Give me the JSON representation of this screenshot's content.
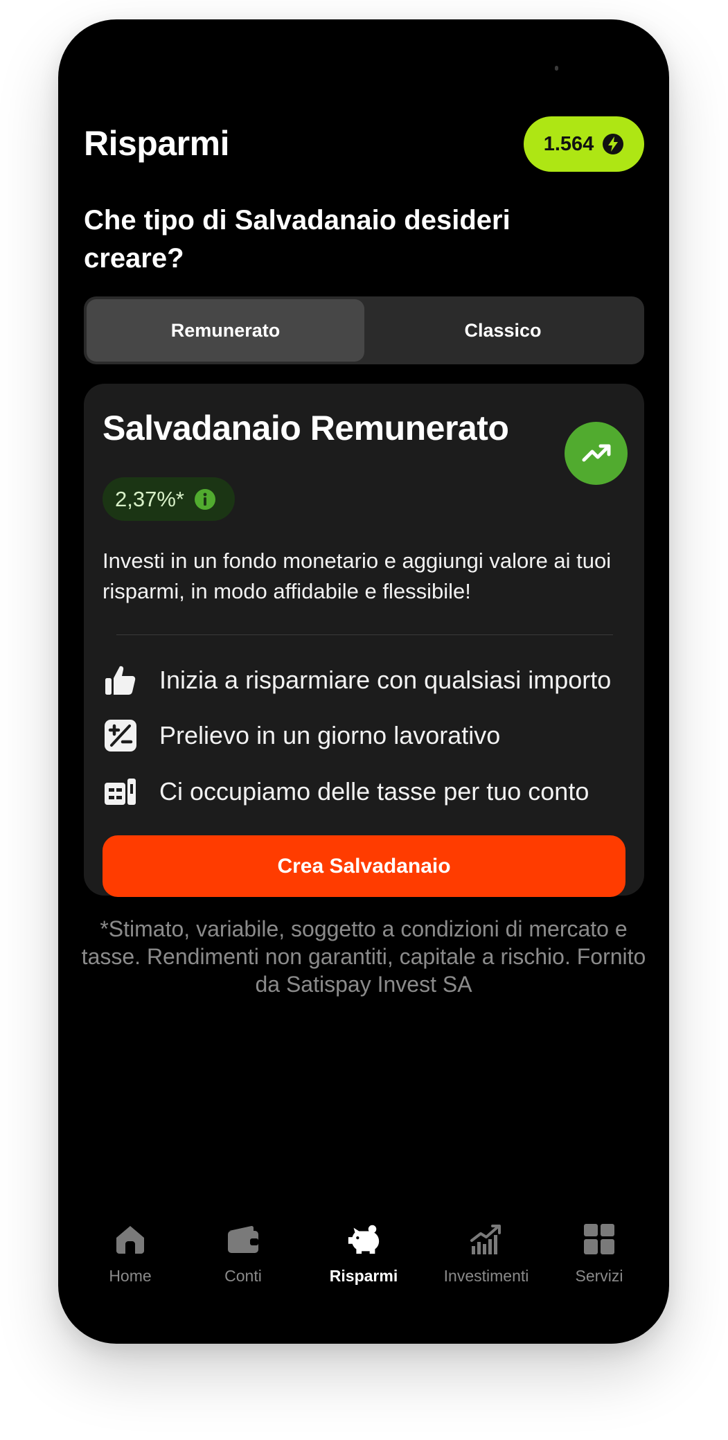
{
  "header": {
    "title": "Risparmi",
    "points": "1.564"
  },
  "question": "Che tipo di Salvadanaio desideri creare?",
  "segments": {
    "active": "Remunerato",
    "inactive": "Classico"
  },
  "card": {
    "title": "Salvadanaio Remunerato",
    "rate": "2,37%*",
    "description": "Investi in un fondo monetario e aggiungi valore ai tuoi risparmi, in modo affidabile e flessibile!",
    "features": [
      {
        "icon": "thumbs-up-icon",
        "text": "Inizia a risparmiare con qualsiasi importo"
      },
      {
        "icon": "plus-minus-icon",
        "text": "Prelievo in un giorno lavorativo"
      },
      {
        "icon": "receipt-icon",
        "text": "Ci occupiamo delle tasse per tuo conto"
      }
    ],
    "cta": "Crea Salvadanaio"
  },
  "disclaimer": "*Stimato, variabile, soggetto a condizioni di mercato e tasse. Rendimenti non garantiti, capitale a rischio. Fornito da Satispay Invest SA",
  "tabs": [
    {
      "label": "Home",
      "icon": "home-icon"
    },
    {
      "label": "Conti",
      "icon": "wallet-icon"
    },
    {
      "label": "Risparmi",
      "icon": "piggy-bank-icon",
      "active": true
    },
    {
      "label": "Investimenti",
      "icon": "chart-icon"
    },
    {
      "label": "Servizi",
      "icon": "grid-icon"
    }
  ],
  "colors": {
    "background": "#000000",
    "accent_green": "#aee614",
    "cta_orange": "#ff3c00",
    "rate_green": "#51ab2f",
    "card_bg": "#1c1c1c"
  }
}
